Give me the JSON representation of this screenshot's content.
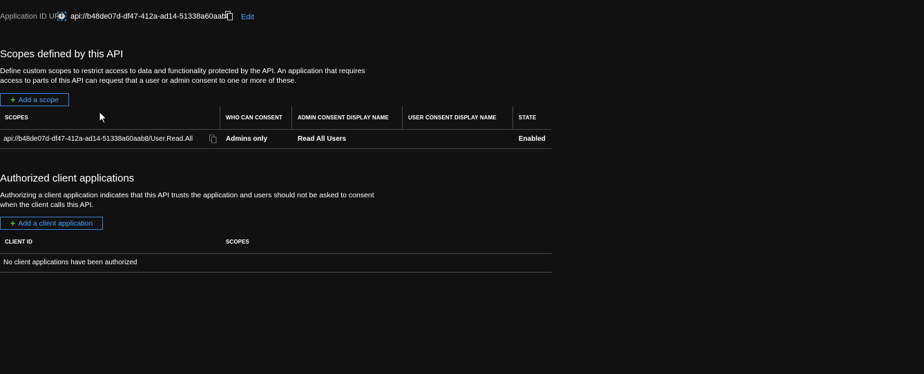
{
  "app_id": {
    "label": "Application ID URI",
    "value": "api://b48de07d-df47-412a-ad14-51338a60aab8",
    "edit_label": "Edit"
  },
  "scopes_section": {
    "title": "Scopes defined by this API",
    "description_line1": "Define custom scopes to restrict access to data and functionality protected by the API. An application that requires",
    "description_line2": "access to parts of this API can request that a user or admin consent to one or more of these.",
    "add_label": "Add a scope",
    "columns": [
      "SCOPES",
      "WHO CAN CONSENT",
      "ADMIN CONSENT DISPLAY NAME",
      "USER CONSENT DISPLAY NAME",
      "STATE"
    ],
    "rows": [
      {
        "scope": "api://b48de07d-df47-412a-ad14-51338a60aab8/User.Read.All",
        "who_can_consent": "Admins only",
        "admin_display_name": "Read All Users",
        "user_display_name": "",
        "state": "Enabled"
      }
    ]
  },
  "clients_section": {
    "title": "Authorized client applications",
    "description_line1": "Authorizing a client application indicates that this API trusts the application and users should not be asked to consent",
    "description_line2": "when the client calls this API.",
    "add_label": "Add a client application",
    "columns": [
      "CLIENT ID",
      "SCOPES"
    ],
    "empty_message": "No client applications have been authorized"
  },
  "colors": {
    "background": "#111111",
    "link": "#4aa3ff",
    "plus": "#5fbf3a",
    "border": "#444444"
  }
}
